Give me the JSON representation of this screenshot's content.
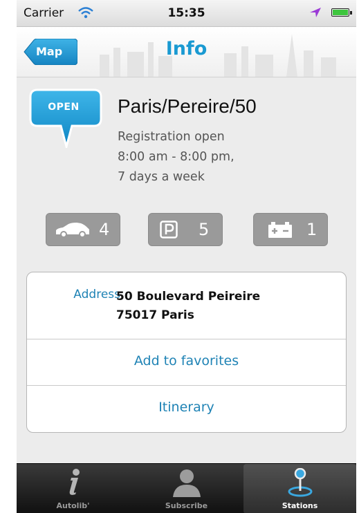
{
  "status_bar": {
    "carrier": "Carrier",
    "time": "15:35"
  },
  "nav": {
    "back_label": "Map",
    "title": "Info"
  },
  "station": {
    "status_badge": "OPEN",
    "name": "Paris/Pereire/50",
    "hours_lines": [
      "Registration open",
      "8:00 am - 8:00 pm,",
      "7 days a week"
    ]
  },
  "availability": {
    "cars": "4",
    "parking": "5",
    "charging": "1"
  },
  "details": {
    "address_label": "Address",
    "address_line1": "50 Boulevard Peireire",
    "address_line2": "75017 Paris",
    "favorites_label": "Add to favorites",
    "itinerary_label": "Itinerary"
  },
  "tabs": [
    {
      "label": "Autolib'",
      "icon": "info-icon"
    },
    {
      "label": "Subscribe",
      "icon": "person-icon"
    },
    {
      "label": "Stations",
      "icon": "station-pin-icon",
      "selected": true
    }
  ],
  "colors": {
    "accent": "#1a9ad2",
    "link": "#1f83b5",
    "badge_gray": "#9a9a9a",
    "tabbar": "#1a1a1a"
  }
}
